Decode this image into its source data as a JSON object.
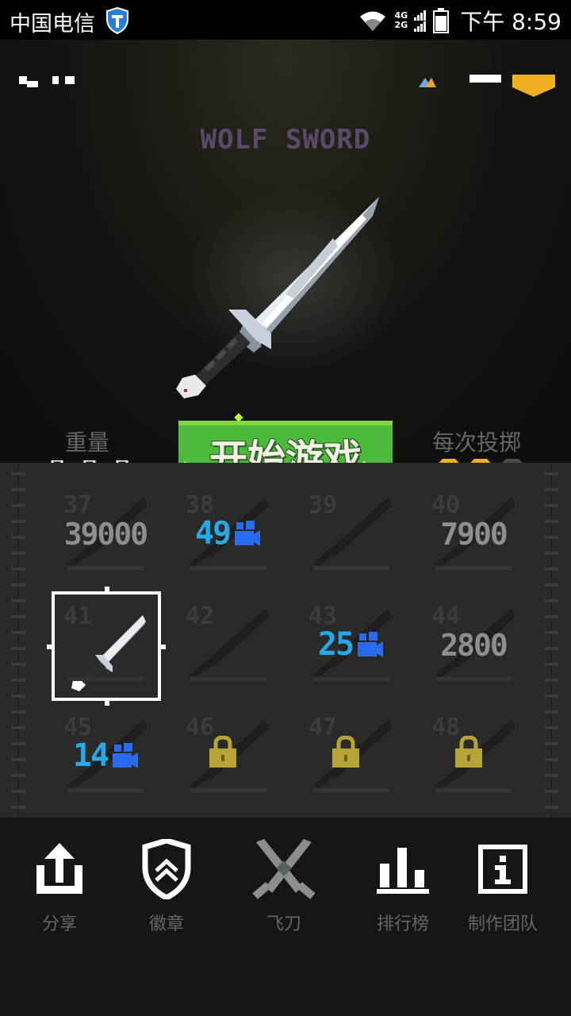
{
  "status_bar": {
    "carrier": "中国电信",
    "network_top": "4G",
    "network_bottom": "2G",
    "time": "下午 8:59"
  },
  "weapon": {
    "name": "WOLF SWORD",
    "weight_label": "重量",
    "weight_level": 3,
    "throw_label": "每次投掷",
    "coins_per_throw": 2,
    "coins_max": 3
  },
  "start_button": {
    "label": "开始游戏"
  },
  "grid": {
    "cells": [
      {
        "num": "37",
        "price": "39000",
        "state": "price"
      },
      {
        "num": "38",
        "video": "49",
        "state": "video"
      },
      {
        "num": "39",
        "state": "owned"
      },
      {
        "num": "40",
        "price": "7900",
        "state": "price"
      },
      {
        "num": "41",
        "state": "selected"
      },
      {
        "num": "42",
        "state": "owned"
      },
      {
        "num": "43",
        "video": "25",
        "state": "video"
      },
      {
        "num": "44",
        "price": "2800",
        "state": "price"
      },
      {
        "num": "45",
        "video": "14",
        "state": "video"
      },
      {
        "num": "46",
        "state": "locked"
      },
      {
        "num": "47",
        "state": "locked"
      },
      {
        "num": "48",
        "state": "locked"
      }
    ]
  },
  "nav": {
    "items": [
      {
        "label": "分享",
        "icon": "share-icon"
      },
      {
        "label": "徽章",
        "icon": "badge-icon"
      },
      {
        "label": "飞刀",
        "icon": "crossed-knives-icon"
      },
      {
        "label": "排行榜",
        "icon": "leaderboard-icon"
      },
      {
        "label": "制作团队",
        "icon": "info-icon"
      }
    ]
  },
  "colors": {
    "start_green": "#4cba3c",
    "video_blue": "#27a8e8",
    "coin_gold": "#f0b020",
    "lock_gold": "#b8a436",
    "title_purple": "#5b4a6a"
  }
}
